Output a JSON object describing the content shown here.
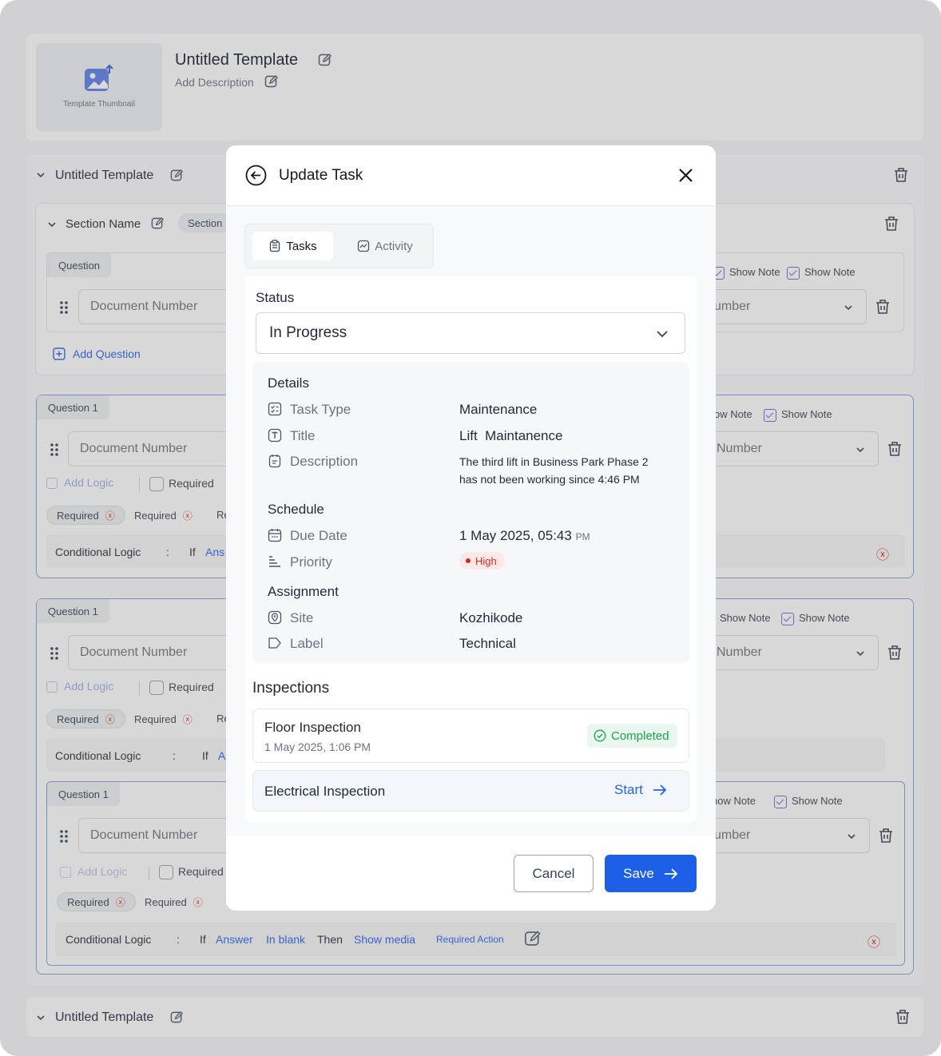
{
  "header": {
    "thumbnail_label": "Template Thumbnail",
    "title": "Untitled Template",
    "description": "Add Description"
  },
  "background": {
    "template_title": "Untitled Template",
    "section_name": "Section Name",
    "section_tag": "Section",
    "question_label": "Question",
    "question1_label": "Question 1",
    "input_placeholder": "Document Number",
    "input_right_partial": "umber",
    "input_right_partial2": "Number",
    "add_question": "Add Question",
    "add_logic": "Add Logic",
    "required": "Required",
    "required_tag": "Required",
    "re_partial": "Re",
    "show_note": "Show Note",
    "show_note_partial": "ow Note",
    "show_note_partial2": "how Note",
    "conditional_logic": "Conditional Logic",
    "colon": ":",
    "if": "If",
    "ans_partial": "Ans",
    "a_partial": "A",
    "answer": "Answer",
    "in_blank": "In blank",
    "then": "Then",
    "show_media": "Show media",
    "required_action": "Required Action",
    "bottom_template_title": "Untitled Template"
  },
  "modal": {
    "title": "Update Task",
    "tabs": [
      {
        "label": "Tasks",
        "active": true
      },
      {
        "label": "Activity",
        "active": false
      }
    ],
    "status_label": "Status",
    "status_value": "In Progress",
    "details_heading": "Details",
    "details": {
      "task_type_label": "Task Type",
      "task_type_value": "Maintenance",
      "title_label": "Title",
      "title_value": "Lift  Maintanence",
      "description_label": "Description",
      "description_line1": "The third lift in Business Park Phase 2",
      "description_line2": "has not been working since 4:46 PM"
    },
    "schedule_heading": "Schedule",
    "schedule": {
      "due_date_label": "Due Date",
      "due_date_value": "1 May 2025, 05:43",
      "due_date_suffix": "PM",
      "priority_label": "Priority",
      "priority_value": "High"
    },
    "assignment_heading": "Assignment",
    "assignment": {
      "site_label": "Site",
      "site_value": "Kozhikode",
      "label_label": "Label",
      "label_value": "Technical"
    },
    "inspections_heading": "Inspections",
    "inspections": [
      {
        "name": "Floor Inspection",
        "date": "1 May 2025, 1:06 PM",
        "status": "Completed"
      },
      {
        "name": "Electrical Inspection",
        "action": "Start"
      }
    ],
    "cancel_label": "Cancel",
    "save_label": "Save"
  },
  "colors": {
    "primary": "#2563eb",
    "success": "#16a34a",
    "danger": "#dc2626",
    "accent_purple": "#7c5fd0"
  }
}
